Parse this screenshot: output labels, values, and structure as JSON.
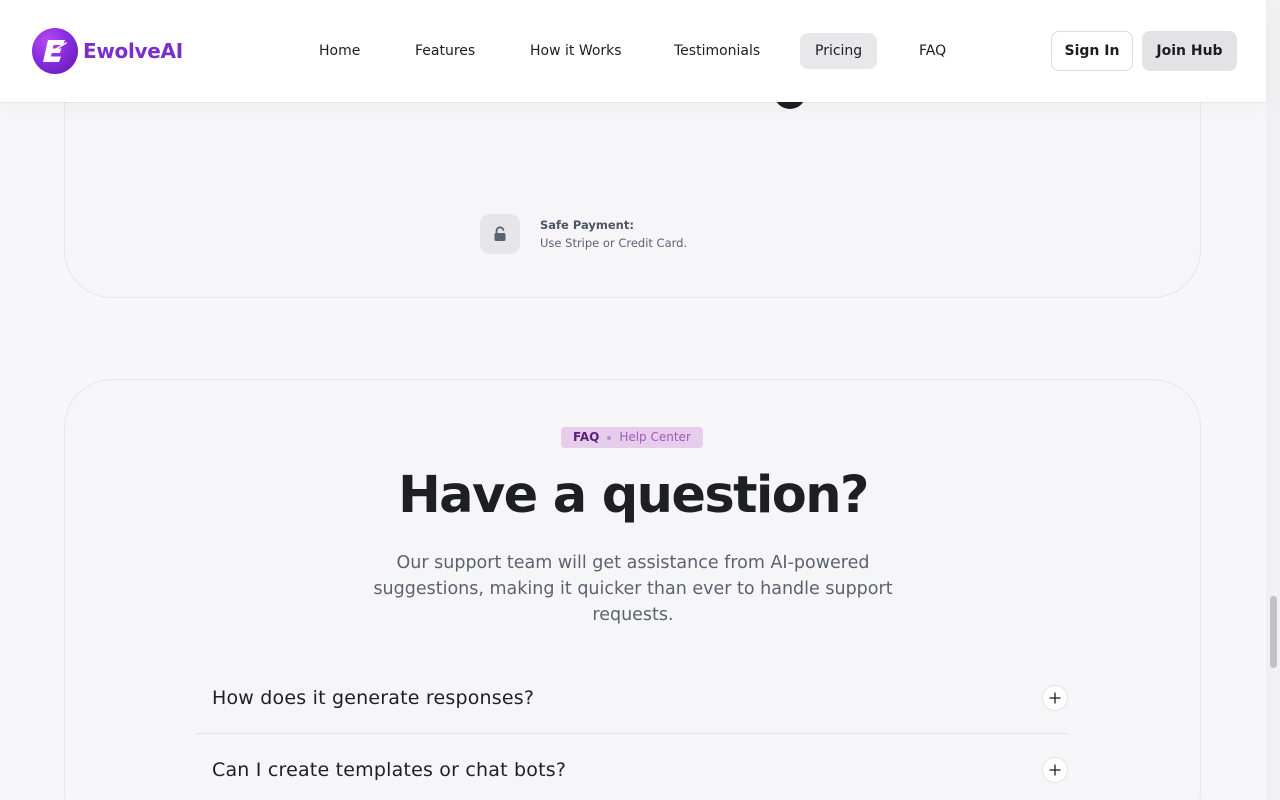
{
  "brand": {
    "name": "EwolveAI",
    "color": "#7b2fc9"
  },
  "nav": {
    "items": [
      {
        "label": "Home",
        "active": false
      },
      {
        "label": "Features",
        "active": false
      },
      {
        "label": "How it Works",
        "active": false
      },
      {
        "label": "Testimonials",
        "active": false
      },
      {
        "label": "Pricing",
        "active": true
      },
      {
        "label": "FAQ",
        "active": false
      }
    ]
  },
  "header_buttons": {
    "sign_in": "Sign In",
    "join": "Join Hub"
  },
  "pricing": {
    "payment_title": "Safe Payment:",
    "payment_desc": "Use Stripe or Credit Card."
  },
  "faq": {
    "badge_primary": "FAQ",
    "badge_secondary": "Help Center",
    "title": "Have a question?",
    "subtitle": "Our support team will get assistance from AI-powered suggestions, making it quicker than ever to handle support requests.",
    "items": [
      {
        "question": "How does it generate responses?"
      },
      {
        "question": "Can I create templates or chat bots?"
      }
    ]
  }
}
